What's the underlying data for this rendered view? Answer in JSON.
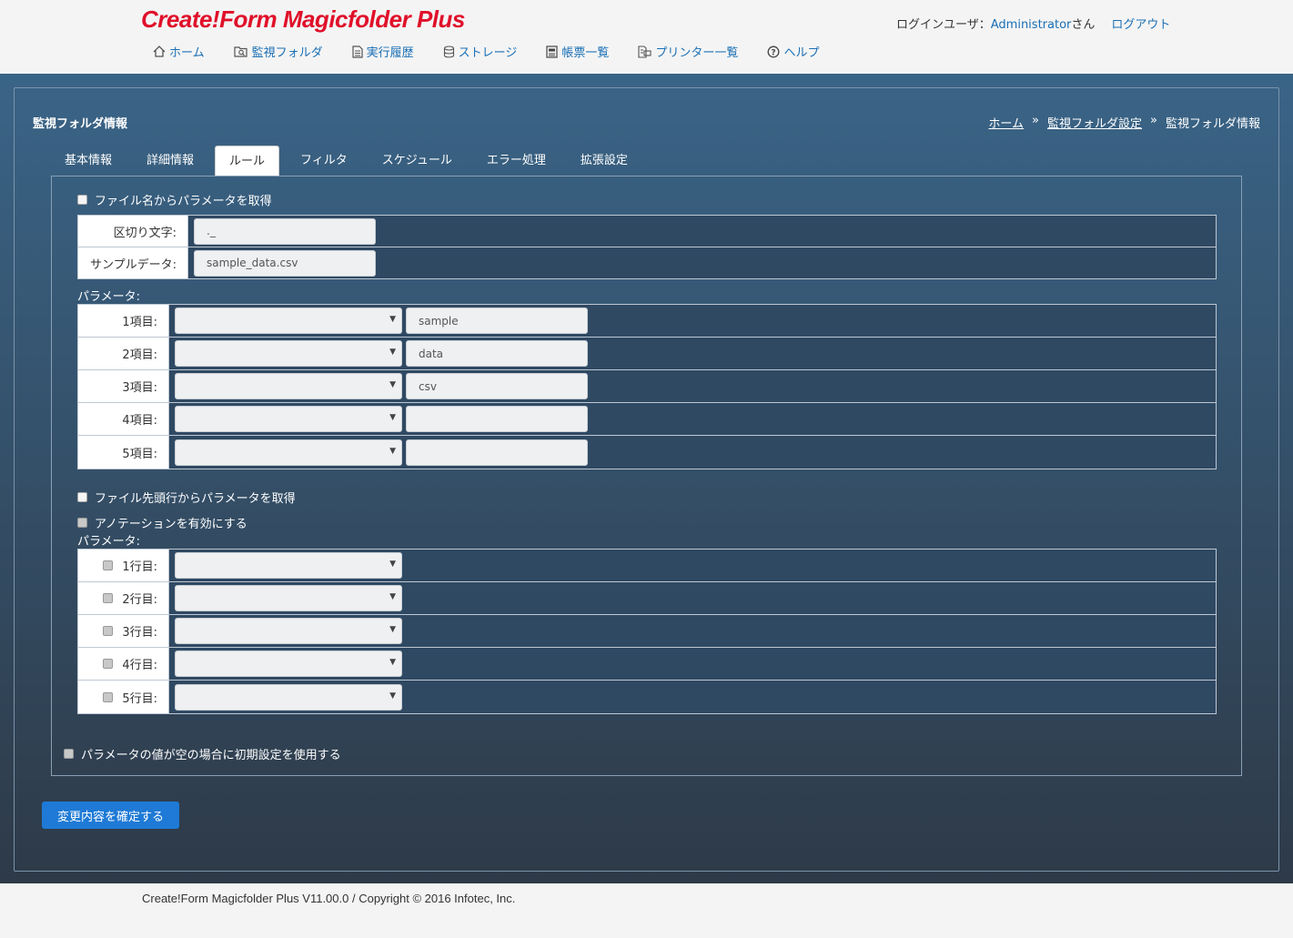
{
  "app": {
    "logo": "Create!Form Magicfolder Plus",
    "login_user_label": "ログインユーザ：",
    "user_name": "Administrator",
    "user_suffix": "さん",
    "logout": "ログアウト"
  },
  "nav": [
    {
      "label": "ホーム",
      "icon": "home-icon"
    },
    {
      "label": "監視フォルダ",
      "icon": "folder-search-icon"
    },
    {
      "label": "実行履歴",
      "icon": "document-icon"
    },
    {
      "label": "ストレージ",
      "icon": "database-icon"
    },
    {
      "label": "帳票一覧",
      "icon": "form-list-icon"
    },
    {
      "label": "プリンター一覧",
      "icon": "printer-icon"
    },
    {
      "label": "ヘルプ",
      "icon": "help-icon"
    }
  ],
  "panel": {
    "title": "監視フォルダ情報",
    "breadcrumb": {
      "home": "ホーム",
      "settings": "監視フォルダ設定",
      "current": "監視フォルダ情報",
      "sep": "»"
    }
  },
  "tabs": [
    {
      "label": "基本情報",
      "active": false
    },
    {
      "label": "詳細情報",
      "active": false
    },
    {
      "label": "ルール",
      "active": true
    },
    {
      "label": "フィルタ",
      "active": false
    },
    {
      "label": "スケジュール",
      "active": false
    },
    {
      "label": "エラー処理",
      "active": false
    },
    {
      "label": "拡張設定",
      "active": false
    }
  ],
  "filename_section": {
    "checkbox_label": "ファイル名からパラメータを取得",
    "delimiter_label": "区切り文字:",
    "delimiter_value": "._",
    "sample_label": "サンプルデータ:",
    "sample_value": "sample_data.csv",
    "params_label": "パラメータ:",
    "items": [
      {
        "label": "1項目:",
        "select": "",
        "value": "sample"
      },
      {
        "label": "2項目:",
        "select": "",
        "value": "data"
      },
      {
        "label": "3項目:",
        "select": "",
        "value": "csv"
      },
      {
        "label": "4項目:",
        "select": "",
        "value": ""
      },
      {
        "label": "5項目:",
        "select": "",
        "value": ""
      }
    ]
  },
  "header_section": {
    "checkbox_label": "ファイル先頭行からパラメータを取得",
    "annotation_label": "アノテーションを有効にする",
    "params_label": "パラメータ:",
    "rows": [
      {
        "label": "1行目:",
        "select": ""
      },
      {
        "label": "2行目:",
        "select": ""
      },
      {
        "label": "3行目:",
        "select": ""
      },
      {
        "label": "4行目:",
        "select": ""
      },
      {
        "label": "5行目:",
        "select": ""
      }
    ]
  },
  "default_checkbox_label": "パラメータの値が空の場合に初期設定を使用する",
  "submit_label": "変更内容を確定する",
  "footer": "Create!Form Magicfolder Plus V11.00.0 / Copyright © 2016 Infotec, Inc."
}
